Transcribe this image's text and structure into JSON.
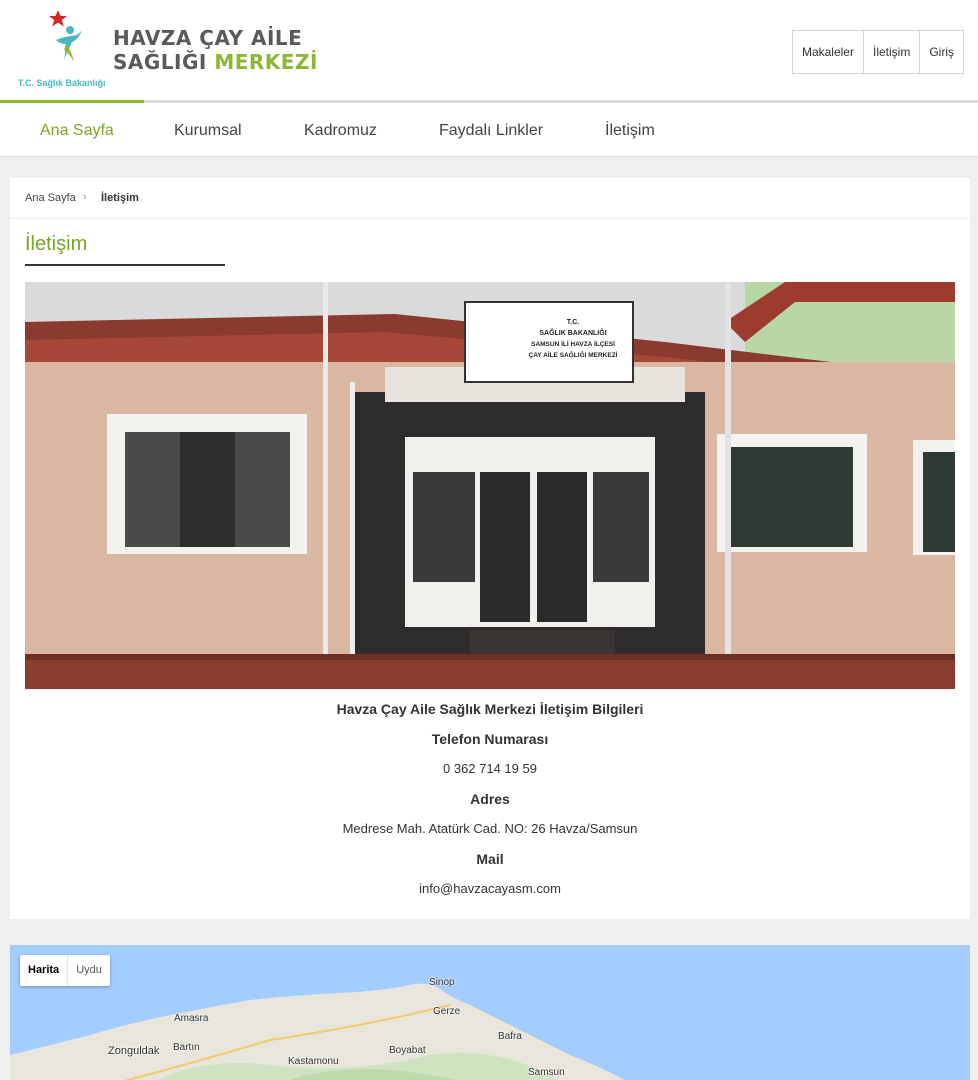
{
  "header": {
    "brand_line1": "HAVZA ÇAY AİLE",
    "brand_line2_main": "SAĞLIĞI ",
    "brand_line2_accent": "MERKEZİ",
    "ministry": "T.C. Sağlık Bakanlığı",
    "top_links": [
      "Makaleler",
      "İletişim",
      "Giriş"
    ]
  },
  "nav": {
    "items": [
      {
        "label": "Ana Sayfa",
        "active": true
      },
      {
        "label": "Kurumsal",
        "active": false
      },
      {
        "label": "Kadromuz",
        "active": false
      },
      {
        "label": "Faydalı Linkler",
        "active": false
      },
      {
        "label": "İletişim",
        "active": false
      }
    ]
  },
  "breadcrumb": {
    "home": "Ana Sayfa",
    "separator": "›",
    "current": "İletişim"
  },
  "page": {
    "title": "İletişim",
    "photo_sign": {
      "line1": "T.C.",
      "line2": "SAĞLIK BAKANLIĞI",
      "line3": "SAMSUN İLİ HAVZA İLÇESİ",
      "line4": "ÇAY AİLE SAĞLIĞI MERKEZİ"
    },
    "contact": {
      "heading": "Havza Çay Aile Sağlık Merkezi İletişim Bilgileri",
      "phone_label": "Telefon Numarası",
      "phone": "0 362 714 19 59",
      "address_label": "Adres",
      "address": "Medrese Mah. Atatürk Cad. NO: 26 Havza/Samsun",
      "mail_label": "Mail",
      "mail": "info@havzacayasm.com"
    }
  },
  "map": {
    "type_options": [
      "Harita",
      "Uydu"
    ],
    "selected": "Harita",
    "cities": [
      "Sinop",
      "Gerze",
      "Amasra",
      "Bartın",
      "Zonguldak",
      "Kastamonu",
      "Boyabat",
      "Bafra",
      "Samsun"
    ]
  },
  "colors": {
    "accent_green": "#7ba428",
    "logo_red": "#d7242b",
    "logo_teal": "#49b6c3",
    "map_sea": "#a3ccff"
  }
}
